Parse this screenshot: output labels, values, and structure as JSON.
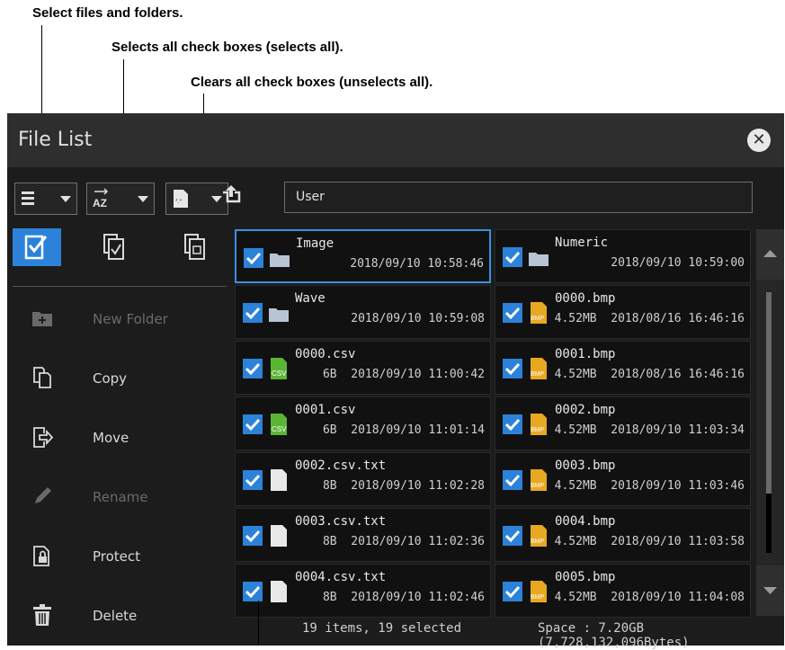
{
  "callouts": {
    "select_files": "Select files and folders.",
    "select_all": "Selects all check boxes (selects all).",
    "clear_all": "Clears all check boxes (unselects all)."
  },
  "window": {
    "title": "File List"
  },
  "path": {
    "value": "User"
  },
  "actions": [
    {
      "label": "New Folder",
      "icon": "new-folder-icon",
      "enabled": false
    },
    {
      "label": "Copy",
      "icon": "copy-icon",
      "enabled": true
    },
    {
      "label": "Move",
      "icon": "move-icon",
      "enabled": true
    },
    {
      "label": "Rename",
      "icon": "rename-icon",
      "enabled": false
    },
    {
      "label": "Protect",
      "icon": "protect-icon",
      "enabled": true
    },
    {
      "label": "Delete",
      "icon": "delete-icon",
      "enabled": true
    }
  ],
  "files": [
    {
      "name": "Image",
      "size": "",
      "date": "2018/09/10 10:58:46",
      "type": "folder",
      "checked": true
    },
    {
      "name": "Numeric",
      "size": "",
      "date": "2018/09/10 10:59:00",
      "type": "folder",
      "checked": true
    },
    {
      "name": "Wave",
      "size": "",
      "date": "2018/09/10 10:59:08",
      "type": "folder",
      "checked": true
    },
    {
      "name": "0000.bmp",
      "size": "4.52MB",
      "date": "2018/08/16 16:46:16",
      "type": "bmp",
      "checked": true
    },
    {
      "name": "0000.csv",
      "size": "6B",
      "date": "2018/09/10 11:00:42",
      "type": "csv",
      "checked": true
    },
    {
      "name": "0001.bmp",
      "size": "4.52MB",
      "date": "2018/08/16 16:46:16",
      "type": "bmp",
      "checked": true
    },
    {
      "name": "0001.csv",
      "size": "6B",
      "date": "2018/09/10 11:01:14",
      "type": "csv",
      "checked": true
    },
    {
      "name": "0002.bmp",
      "size": "4.52MB",
      "date": "2018/09/10 11:03:34",
      "type": "bmp",
      "checked": true
    },
    {
      "name": "0002.csv.txt",
      "size": "8B",
      "date": "2018/09/10 11:02:28",
      "type": "txt",
      "checked": true
    },
    {
      "name": "0003.bmp",
      "size": "4.52MB",
      "date": "2018/09/10 11:03:46",
      "type": "bmp",
      "checked": true
    },
    {
      "name": "0003.csv.txt",
      "size": "8B",
      "date": "2018/09/10 11:02:36",
      "type": "txt",
      "checked": true
    },
    {
      "name": "0004.bmp",
      "size": "4.52MB",
      "date": "2018/09/10 11:03:58",
      "type": "bmp",
      "checked": true
    },
    {
      "name": "0004.csv.txt",
      "size": "8B",
      "date": "2018/09/10 11:02:46",
      "type": "txt",
      "checked": true
    },
    {
      "name": "0005.bmp",
      "size": "4.52MB",
      "date": "2018/09/10 11:04:08",
      "type": "bmp",
      "checked": true
    }
  ],
  "status": {
    "count": "19 items, 19 selected",
    "space": "Space : 7.20GB (7,728,132,096Bytes)"
  },
  "colors": {
    "accent": "#2b82d8",
    "csv_icon": "#5bb534",
    "bmp_icon": "#e8a820"
  }
}
